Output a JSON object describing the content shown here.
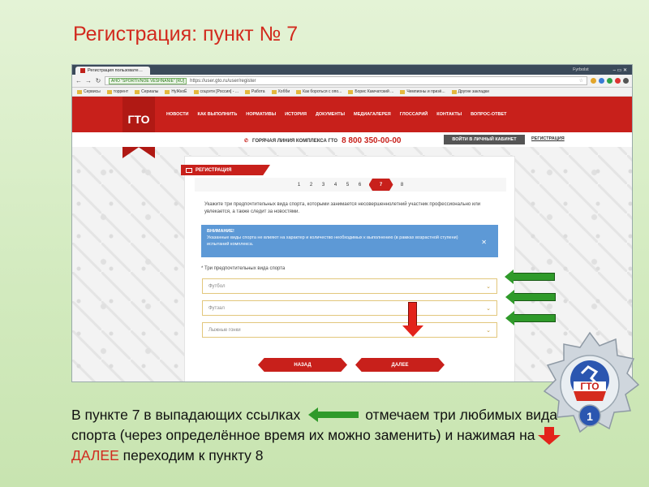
{
  "slide": {
    "title": "Регистрация: пункт  № 7",
    "caption_parts": {
      "part1": "В пункте 7 в выпадающих  ссылках",
      "part2": "отмечаем три любимых вида  спорта (через определённое время их можно заменить) и нажимая на",
      "part3": "ДАЛЕЕ",
      "part4": "переходим к пункту 8"
    },
    "medal": {
      "label": "ГТО",
      "number": "1"
    }
  },
  "browser": {
    "tab_title": "Регистрация пользовате…",
    "tab_user": "Fyrbolst",
    "window_controls": "–  ▭  ✕",
    "site_badge": "АНО \"SPORTIVNOE VESHNANIE\" [RU]",
    "url": "https://user.gto.ru/user/register",
    "bookmarks": [
      "Сервисы",
      "торрент",
      "Сериалы",
      "НуЖкоЁ",
      "соцсети [Россия] - ...",
      "Работа",
      "Хобби",
      "Как бороться с опо...",
      "Борис Камчатский ...",
      "Чемпионы и призё...",
      "Другие закладки"
    ]
  },
  "site": {
    "logo": "ГТО",
    "nav": [
      "НОВОСТИ",
      "КАК ВЫПОЛНИТЬ",
      "НОРМАТИВЫ",
      "ИСТОРИЯ",
      "ДОКУМЕНТЫ",
      "МЕДИАГАЛЕРЕЯ",
      "ГЛОССАРИЙ",
      "КОНТАКТЫ",
      "ВОПРОС-ОТВЕТ"
    ],
    "hotline_label": "ГОРЯЧАЯ ЛИНИЯ КОМПЛЕКСА ГТО",
    "hotline_phone": "8 800 350-00-00",
    "cabinet_button": "ВОЙТИ В ЛИЧНЫЙ КАБИНЕТ",
    "register_link": "РЕГИСТРАЦИЯ"
  },
  "form": {
    "header": "РЕГИСТРАЦИЯ",
    "steps": [
      "1",
      "2",
      "3",
      "4",
      "5",
      "6",
      "7",
      "8"
    ],
    "active_step": "7",
    "intro": "Укажите три предпочтительных вида спорта, которыми занимается несовершеннолетний участник профессионально или увлекается, а также следит за новостями.",
    "notice_title": "ВНИМАНИЕ!",
    "notice_text": "Указанные виды спорта не влияют на характер и количество необходимых к выполнению (в рамках возрастной ступени) испытаний комплекса.",
    "sports_label": "* Три предпочтительных вида спорта",
    "selects": [
      "Футбол",
      "Футзал",
      "Лыжные гонки"
    ],
    "back_button": "НАЗАД",
    "next_button": "ДАЛЕЕ"
  }
}
